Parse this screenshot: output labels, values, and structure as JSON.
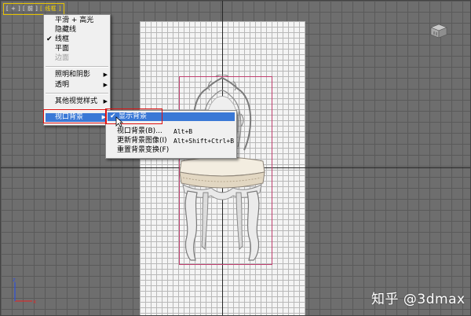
{
  "viewport": {
    "label_prefix": "[ + ] [ 前 ] ",
    "label_mode": "[ 线框 ]"
  },
  "main_menu": {
    "items": [
      {
        "label": "平滑 + 高光",
        "checked": false,
        "disabled": false,
        "submenu": false
      },
      {
        "label": "隐藏线",
        "checked": false,
        "disabled": false,
        "submenu": false
      },
      {
        "label": "线框",
        "checked": true,
        "disabled": false,
        "submenu": false
      },
      {
        "label": "平面",
        "checked": false,
        "disabled": false,
        "submenu": false
      },
      {
        "label": "边面",
        "checked": false,
        "disabled": true,
        "submenu": false
      },
      {
        "label": "照明和阴影",
        "checked": false,
        "disabled": false,
        "submenu": true
      },
      {
        "label": "透明",
        "checked": false,
        "disabled": false,
        "submenu": true
      },
      {
        "label": "其他视觉样式",
        "checked": false,
        "disabled": false,
        "submenu": true
      },
      {
        "label": "视口背景",
        "checked": false,
        "disabled": false,
        "submenu": true,
        "highlighted": true
      }
    ]
  },
  "submenu": {
    "items": [
      {
        "label": "显示背景",
        "shortcut": "",
        "checked": true,
        "highlighted": true
      },
      {
        "label": "视口背景(B)...",
        "shortcut": "Alt+B",
        "checked": false
      },
      {
        "label": "更新背景图像(I)",
        "shortcut": "Alt+Shift+Ctrl+B",
        "checked": false
      },
      {
        "label": "重置背景变换(F)",
        "shortcut": "",
        "checked": false
      }
    ]
  },
  "watermark": "知乎 @3dmax",
  "icons": {
    "check": "✔",
    "submenu_arrow": "▶",
    "viewcube": "viewcube-icon",
    "axis_gizmo": "axis-gizmo-icon",
    "cursor": "mouse-cursor-icon"
  },
  "colors": {
    "highlight": "#3a78d6",
    "annotation_red": "#e01010",
    "selection_box": "#c04070"
  }
}
